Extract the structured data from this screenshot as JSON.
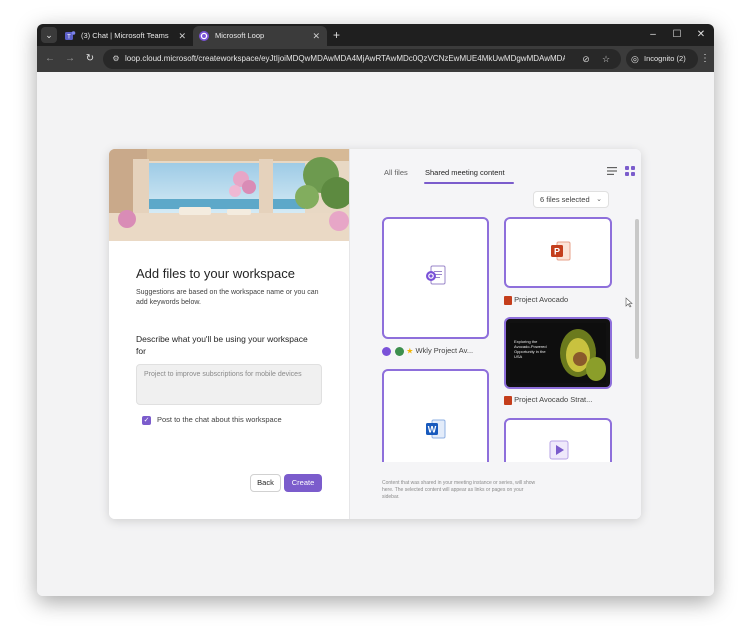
{
  "browser": {
    "tabs": [
      {
        "title": "(3) Chat | Microsoft Teams",
        "icon": "teams-icon"
      },
      {
        "title": "Microsoft Loop",
        "icon": "loop-icon"
      }
    ],
    "url": "loop.cloud.microsoft/createworkspace/eyJtIjoiMDQwMDAwMDA4MjAwRTAwMDc0QzVCNzEwMUE4MkUwMDgwMDAwMDA",
    "incognito_label": "Incognito (2)"
  },
  "dialog": {
    "title": "Add files to your workspace",
    "subtitle": "Suggestions are based on the workspace name or you can add keywords below.",
    "describe_label": "Describe what you'll be using your workspace for",
    "describe_value": "Project to improve subscriptions for mobile devices",
    "post_to_chat_label": "Post to the chat about this workspace",
    "post_to_chat_checked": true,
    "back_label": "Back",
    "create_label": "Create"
  },
  "files_panel": {
    "tabs": [
      "All files",
      "Shared meeting content"
    ],
    "active_tab": "Shared meeting content",
    "selection_label": "6 files selected",
    "files": [
      {
        "name": "Wkly Project Av...",
        "type": "loop"
      },
      {
        "name": "Project Avocado",
        "type": "powerpoint"
      },
      {
        "name": "Project Avocado Strat...",
        "type": "powerpoint"
      },
      {
        "name": "",
        "type": "word"
      },
      {
        "name": "",
        "type": "video"
      }
    ],
    "thumbnail_text": "Exploring the Avocado-Powered Opportunity in the USA",
    "footnote": "Content that was shared in your meeting instance or series, will show here. The selected content will appear as links or pages on your sidebar."
  },
  "colors": {
    "accent": "#7b5ccc",
    "card_border": "#8e6fdb",
    "chrome_dark": "#1f1f1f"
  }
}
